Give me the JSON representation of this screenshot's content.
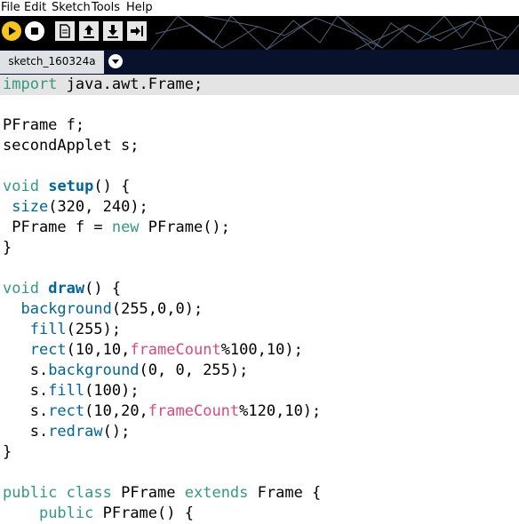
{
  "menubar": {
    "items": [
      "File",
      "Edit",
      "Sketch",
      "Tools",
      "Help"
    ]
  },
  "toolbar": {
    "buttons": [
      "run-icon",
      "stop-icon",
      "new-icon",
      "open-icon",
      "save-icon",
      "export-icon"
    ],
    "colors": {
      "run": "#f5c518",
      "stop_bg": "#ffffff",
      "square_bg": "#e6e6e6"
    }
  },
  "tabs": {
    "active": "sketch_160324a"
  },
  "colors": {
    "keyword": "#33997e",
    "function": "#006699",
    "builtin_var": "#d94a7a",
    "current_line": "#e4e4e4",
    "tab_strip": "#08122c"
  },
  "code": {
    "lines": [
      "import java.awt.Frame;",
      "",
      "PFrame f;",
      "secondApplet s;",
      "",
      "void setup() {",
      " size(320, 240);",
      " PFrame f = new PFrame();",
      "}",
      "",
      "void draw() {",
      "  background(255,0,0);",
      "   fill(255);",
      "   rect(10,10,frameCount%100,10);",
      "   s.background(0, 0, 255);",
      "   s.fill(100);",
      "   s.rect(10,20,frameCount%120,10);",
      "   s.redraw();",
      "}",
      "",
      "public class PFrame extends Frame {",
      "    public PFrame() {"
    ]
  }
}
